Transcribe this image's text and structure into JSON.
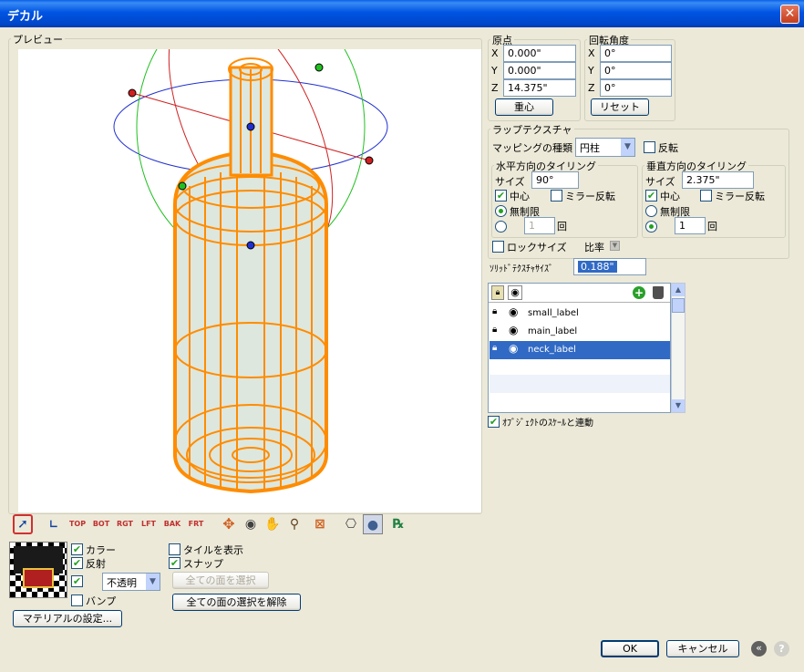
{
  "window": {
    "title": "デカル",
    "close": "✕"
  },
  "preview": {
    "label": "プレビュー"
  },
  "origin": {
    "label": "原点",
    "x_label": "X",
    "y_label": "Y",
    "z_label": "Z",
    "x": "0.000\"",
    "y": "0.000\"",
    "z": "14.375\"",
    "center_button": "重心"
  },
  "rotation": {
    "label": "回転角度",
    "x_label": "X",
    "y_label": "Y",
    "z_label": "Z",
    "x": "0°",
    "y": "0°",
    "z": "0°",
    "reset_button": "リセット"
  },
  "wrap": {
    "label": "ラップテクスチャ",
    "mapping_label": "マッピングの種類",
    "mapping_value": "円柱",
    "flip_label": "反転",
    "horizontal": {
      "label": "水平方向のタイリング",
      "size_label": "サイズ",
      "size": "90°",
      "center_label": "中心",
      "mirror_label": "ミラー反転",
      "infinite_label": "無制限",
      "count": "1",
      "count_suffix": "回"
    },
    "vertical": {
      "label": "垂直方向のタイリング",
      "size_label": "サイズ",
      "size": "2.375\"",
      "center_label": "中心",
      "mirror_label": "ミラー反転",
      "infinite_label": "無制限",
      "count": "1",
      "count_suffix": "回"
    },
    "lock_size_label": "ロックサイズ",
    "ratio_label": "比率"
  },
  "solid_texture": {
    "label": "ｿﾘｯﾄﾞﾃｸｽﾁｬｻｲｽﾞ",
    "value": "0.188\""
  },
  "layers": [
    {
      "name": "small_label",
      "selected": false
    },
    {
      "name": "main_label",
      "selected": false
    },
    {
      "name": "neck_label",
      "selected": true
    }
  ],
  "link_scale_label": "ｵﾌﾞｼﾞｪｸﾄのｽｹｰﾙと連動",
  "toolbar": {
    "views": [
      "TOP",
      "BOT",
      "RGT",
      "LFT",
      "BAK",
      "FRT"
    ]
  },
  "material": {
    "color_label": "カラー",
    "reflect_label": "反射",
    "opacity_value": "不透明",
    "bump_label": "バンプ",
    "settings_button": "マテリアルの設定..."
  },
  "options": {
    "show_tiles_label": "タイルを表示",
    "snap_label": "スナップ",
    "select_all_button": "全ての面を選択",
    "deselect_all_button": "全ての面の選択を解除"
  },
  "footer": {
    "ok": "OK",
    "cancel": "キャンセル",
    "back": "«",
    "help": "?"
  }
}
